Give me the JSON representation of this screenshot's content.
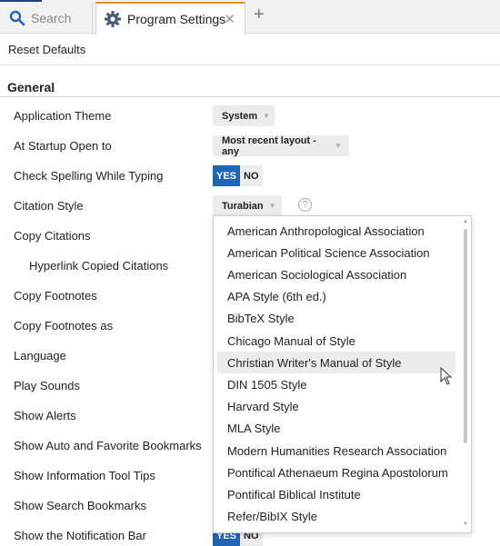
{
  "tabs": {
    "search_label": "Search",
    "settings_label": "Program Settings",
    "close": "✕",
    "add": "+"
  },
  "toolbar": {
    "reset_label": "Reset Defaults"
  },
  "section": {
    "title": "General"
  },
  "settings": {
    "application_theme": {
      "label": "Application Theme",
      "value": "System"
    },
    "startup_open": {
      "label": "At Startup Open to",
      "value": "Most recent layout - any"
    },
    "check_spelling": {
      "label": "Check Spelling While Typing",
      "yes": "YES",
      "no": "NO"
    },
    "citation_style": {
      "label": "Citation Style",
      "value": "Turabian"
    },
    "copy_citations": {
      "label": "Copy Citations"
    },
    "hyperlink_copied": {
      "label": "Hyperlink Copied Citations"
    },
    "copy_footnotes": {
      "label": "Copy Footnotes"
    },
    "copy_footnotes_as": {
      "label": "Copy Footnotes as"
    },
    "language": {
      "label": "Language"
    },
    "play_sounds": {
      "label": "Play Sounds"
    },
    "show_alerts": {
      "label": "Show Alerts"
    },
    "show_auto_fav": {
      "label": "Show Auto and Favorite Bookmarks"
    },
    "show_info_tips": {
      "label": "Show Information Tool Tips"
    },
    "show_search_bookmarks": {
      "label": "Show Search Bookmarks"
    },
    "show_notification": {
      "label": "Show the Notification Bar",
      "yes": "YES",
      "no": "NO"
    }
  },
  "help": "?",
  "citation_options": [
    "American Anthropological Association",
    "American Political Science Association",
    "American Sociological Association",
    "APA Style (6th ed.)",
    "BibTeX Style",
    "Chicago Manual of Style",
    "Christian Writer's Manual of Style",
    "DIN 1505 Style",
    "Harvard Style",
    "MLA Style",
    "Modern Humanities Research Association",
    "Pontifical Athenaeum Regina Apostolorum",
    "Pontifical Biblical Institute",
    "Refer/BibIX Style"
  ],
  "hovered_option": "Christian Writer's Manual of Style",
  "colors": {
    "accent_tab": "#f08a24",
    "toggle_yes": "#1f65b5",
    "brand_line": "#1f3f7a"
  }
}
